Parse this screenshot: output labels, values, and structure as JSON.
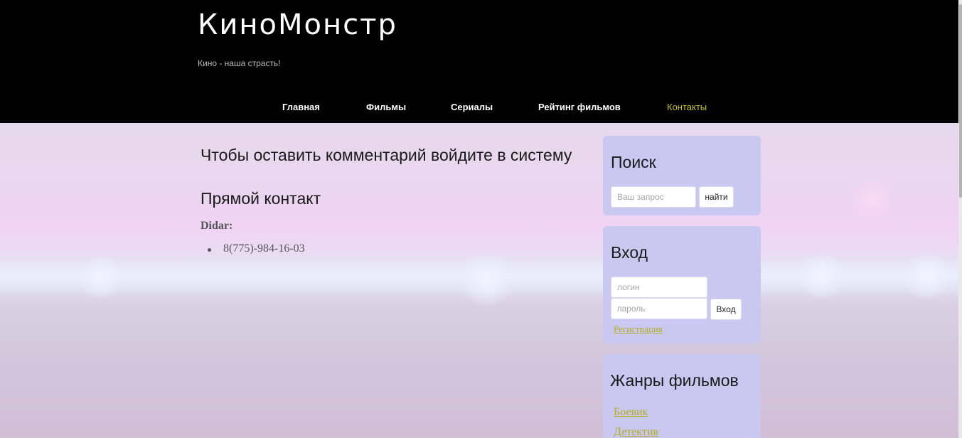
{
  "site": {
    "title": "КиноМонстр",
    "tagline": "Кино - наша страсть!"
  },
  "nav": {
    "items": [
      {
        "label": "Главная",
        "active": false
      },
      {
        "label": "Фильмы",
        "active": false
      },
      {
        "label": "Сериалы",
        "active": false
      },
      {
        "label": "Рейтинг фильмов",
        "active": false
      },
      {
        "label": "Контакты",
        "active": true
      }
    ]
  },
  "main": {
    "comment_note": "Чтобы оставить комментарий войдите в систему",
    "contact_heading": "Прямой контакт",
    "contact_name": "Didar:",
    "phones": [
      "8(775)-984-16-03"
    ]
  },
  "search": {
    "title": "Поиск",
    "placeholder": "Ваш запрос",
    "button": "найти"
  },
  "login": {
    "title": "Вход",
    "login_placeholder": "логин",
    "password_placeholder": "пароль",
    "button": "Вход",
    "register_link": "Регистрация"
  },
  "genres": {
    "title": "Жанры фильмов",
    "items": [
      "Боевик",
      "Детектив"
    ]
  },
  "colors": {
    "header_bg": "#000000",
    "accent_yellow": "#c9c227",
    "widget_bg": "#c9c8f1"
  }
}
